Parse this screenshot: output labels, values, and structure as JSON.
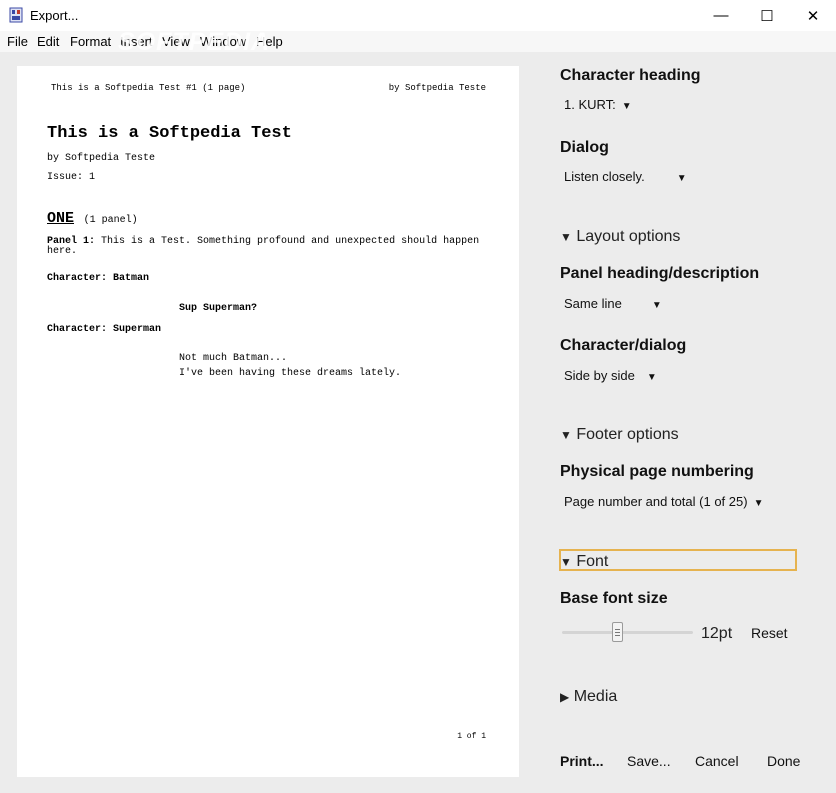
{
  "window": {
    "title": "Export...",
    "minimize": "—",
    "maximize": "☐",
    "close": "✕"
  },
  "menu": [
    "File",
    "Edit",
    "Format",
    "Insert",
    "View",
    "Window",
    "Help"
  ],
  "watermark": "SOFTPEDIA",
  "preview": {
    "header_left": "This is a Softpedia Test #1 (1 page)",
    "header_right": "by Softpedia Teste",
    "title": "This is a Softpedia Test",
    "byline": "by Softpedia Teste",
    "issue": "Issue: 1",
    "page_heading": "ONE",
    "page_count": "(1 panel)",
    "panel_label": "Panel 1:",
    "panel_desc_line1": "This is a Test. Something profound and unexpected should happen",
    "panel_desc_line2": "here.",
    "char1": "Character: Batman",
    "dialog1": "Sup Superman?",
    "char2": "Character: Superman",
    "dialog2_line1": "Not much Batman...",
    "dialog2_line2": "I've been having these dreams lately.",
    "footer": "1 of 1"
  },
  "options": {
    "character_heading": {
      "label": "Character heading",
      "value": "1. KURT:"
    },
    "dialog": {
      "label": "Dialog",
      "value": "Listen closely."
    },
    "layout_section": "Layout options",
    "panel_heading": {
      "label": "Panel heading/description",
      "value": "Same line"
    },
    "character_dialog": {
      "label": "Character/dialog",
      "value": "Side by side"
    },
    "footer_section": "Footer options",
    "page_numbering": {
      "label": "Physical page numbering",
      "value": "Page number and total (1 of 25)"
    },
    "font_section": "Font",
    "base_font_size": {
      "label": "Base font size",
      "value": "12pt",
      "reset": "Reset",
      "slider_fraction": 0.42
    },
    "media_section": "Media"
  },
  "buttons": {
    "print": "Print...",
    "save": "Save...",
    "cancel": "Cancel",
    "done": "Done"
  },
  "icons": {
    "expanded": "▼",
    "collapsed": "▶",
    "dropdown": "▼"
  },
  "colors": {
    "focus_outline": "#e6b34f",
    "page_bg": "#ffffff",
    "panel_bg": "#ececec"
  }
}
